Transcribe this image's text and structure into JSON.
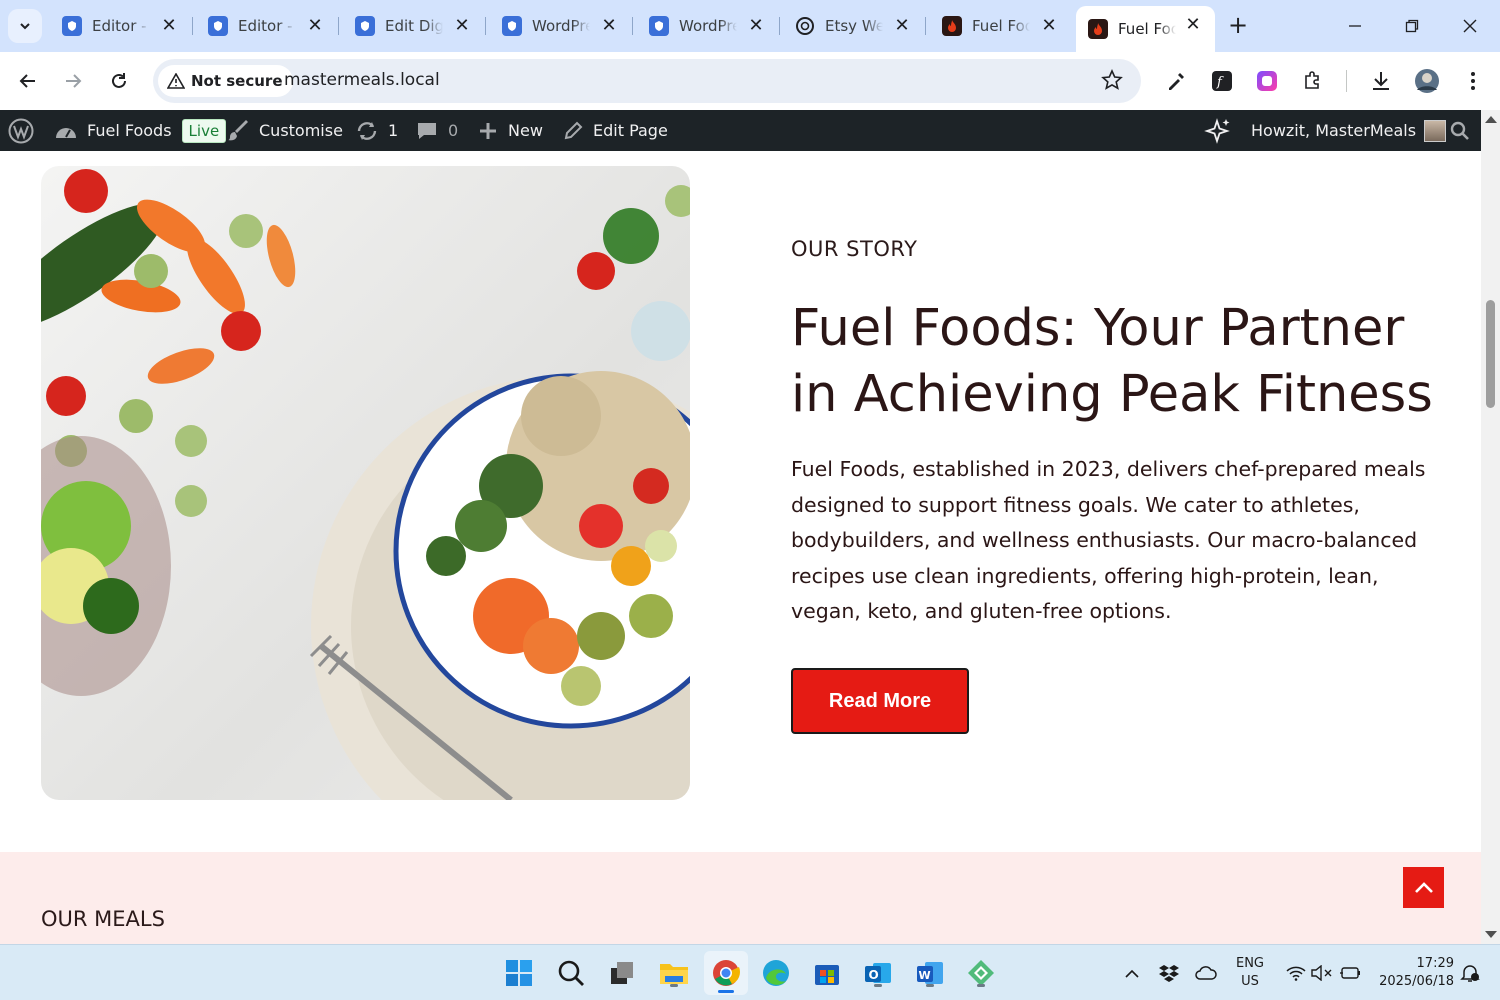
{
  "browser": {
    "tabs": [
      {
        "title": "Editor - Fuel Foods",
        "icon": "wordpress-shield-icon"
      },
      {
        "title": "Editor - Fuel Foods",
        "icon": "wordpress-shield-icon"
      },
      {
        "title": "Edit Digital Product",
        "icon": "wordpress-shield-icon"
      },
      {
        "title": "WordPress",
        "icon": "wordpress-shield-icon"
      },
      {
        "title": "WordPress",
        "icon": "wordpress-shield-icon"
      },
      {
        "title": "Etsy Web",
        "icon": "openai-icon"
      },
      {
        "title": "Fuel Foods",
        "icon": "flame-icon"
      },
      {
        "title": "Fuel Foods",
        "icon": "flame-icon",
        "active": true
      }
    ],
    "security_label": "Not secure",
    "url": "mastermeals.local"
  },
  "wp_admin_bar": {
    "site_name": "Fuel Foods",
    "live_badge": "Live",
    "customise": "Customise",
    "updates_count": "1",
    "comments_count": "0",
    "new": "New",
    "edit_page": "Edit Page",
    "greeting": "Howzit, MasterMeals"
  },
  "story": {
    "eyebrow": "OUR STORY",
    "headline": "Fuel Foods: Your Partner in Achieving Peak Fitness",
    "body": "Fuel Foods, established in 2023, delivers chef-prepared meals designed to support fitness goals. We cater to athletes, bodybuilders, and wellness enthusiasts. Our macro-balanced recipes use clean ingredients, offering high-protein, lean, vegan, keto, and gluten-free options.",
    "cta": "Read More"
  },
  "meals": {
    "title": "OUR MEALS"
  },
  "colors": {
    "accent_red": "#e51b14",
    "heading": "#2b1616",
    "meals_bg": "#fdeceb",
    "admin_bar": "#1d2327"
  },
  "taskbar": {
    "language": "ENG",
    "region": "US",
    "time": "17:29",
    "date": "2025/06/18"
  }
}
